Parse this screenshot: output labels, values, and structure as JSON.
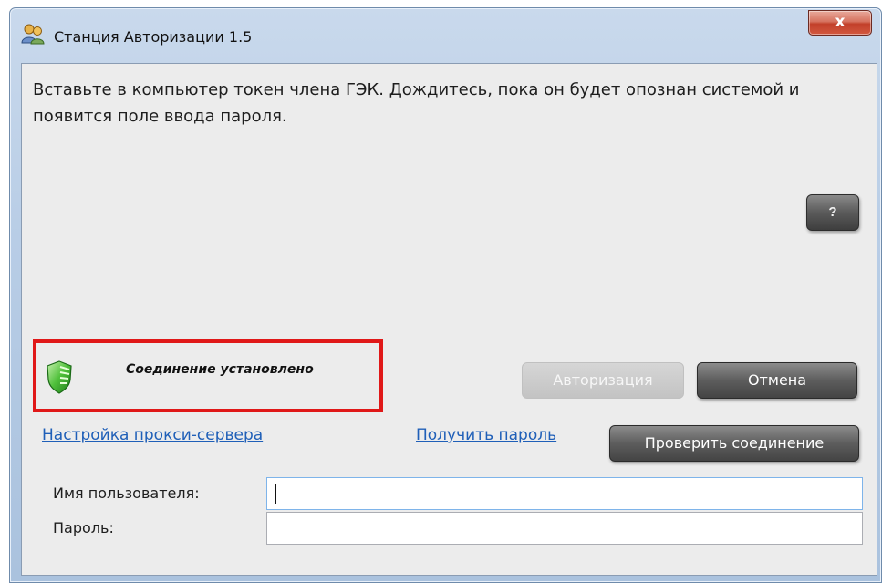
{
  "window": {
    "title": "Станция Авторизации 1.5",
    "app_icon": "users-icon",
    "close_label": "x"
  },
  "main": {
    "instructions": "Вставьте в компьютер токен члена ГЭК. Дождитесь, пока он будет опознан системой и появится поле ввода пароля.",
    "help_label": "?"
  },
  "status": {
    "icon": "shield-icon",
    "text": "Соединение установлено",
    "highlight_color": "#e01818"
  },
  "buttons": {
    "authorize": "Авторизация",
    "cancel": "Отмена",
    "check_connection": "Проверить соединение"
  },
  "links": {
    "proxy_settings": "Настройка прокси-сервера",
    "get_password": "Получить пароль"
  },
  "form": {
    "username_label": "Имя пользователя:",
    "username_value": "",
    "password_label": "Пароль:",
    "password_value": ""
  }
}
